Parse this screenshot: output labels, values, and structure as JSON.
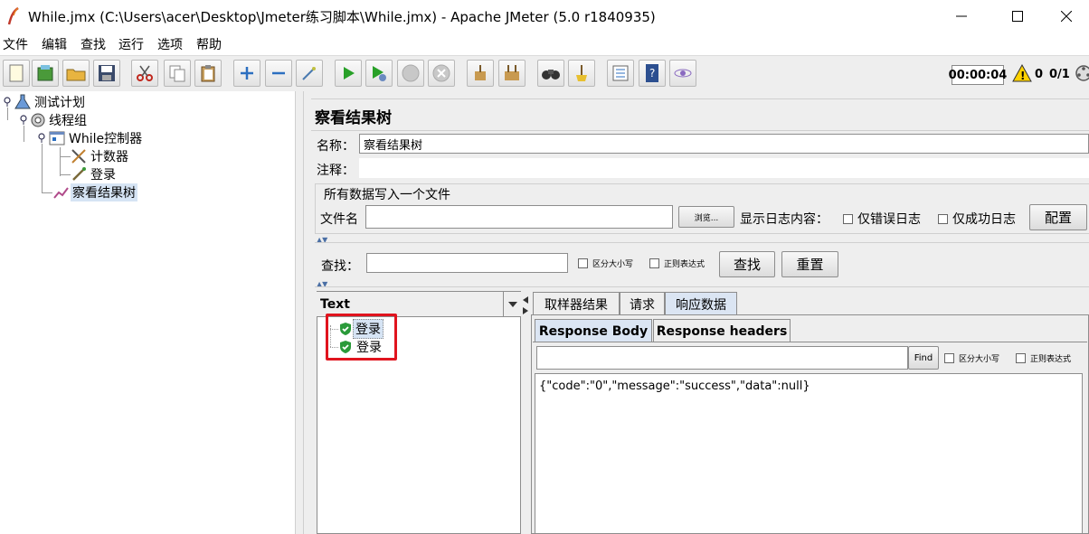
{
  "window": {
    "title": "While.jmx (C:\\Users\\acer\\Desktop\\Jmeter练习脚本\\While.jmx) - Apache JMeter (5.0 r1840935)"
  },
  "menu": {
    "items": [
      "文件",
      "编辑",
      "查找",
      "运行",
      "选项",
      "帮助"
    ]
  },
  "status": {
    "timer": "00:00:04",
    "warnings": "0",
    "threads": "0/1"
  },
  "tree": {
    "items": [
      "测试计划",
      "线程组",
      "While控制器",
      "计数器",
      "登录",
      "察看结果树"
    ]
  },
  "panel": {
    "title": "察看结果树",
    "name_label": "名称：",
    "name_value": "察看结果树",
    "comment_label": "注释：",
    "comment_value": "",
    "file_section": "所有数据写入一个文件",
    "file_label": "文件名",
    "file_value": "",
    "browse_button": "浏览...",
    "log_label": "显示日志内容：",
    "errors_only": "仅错误日志",
    "success_only": "仅成功日志",
    "config_button": "配置"
  },
  "search": {
    "label": "查找：",
    "value": "",
    "case_sensitive": "区分大小写",
    "regex": "正则表达式",
    "find_button": "查找",
    "reset_button": "重置"
  },
  "results": {
    "renderer": "Text",
    "samples": [
      "登录",
      "登录"
    ]
  },
  "tabs": {
    "sampler_result": "取样器结果",
    "request": "请求",
    "response_data": "响应数据"
  },
  "subtabs": {
    "body": "Response Body",
    "headers": "Response headers"
  },
  "response": {
    "find_button": "Find",
    "case_sensitive": "区分大小写",
    "regex": "正则表达式",
    "search_value": "",
    "body": "{\"code\":\"0\",\"message\":\"success\",\"data\":null}"
  }
}
